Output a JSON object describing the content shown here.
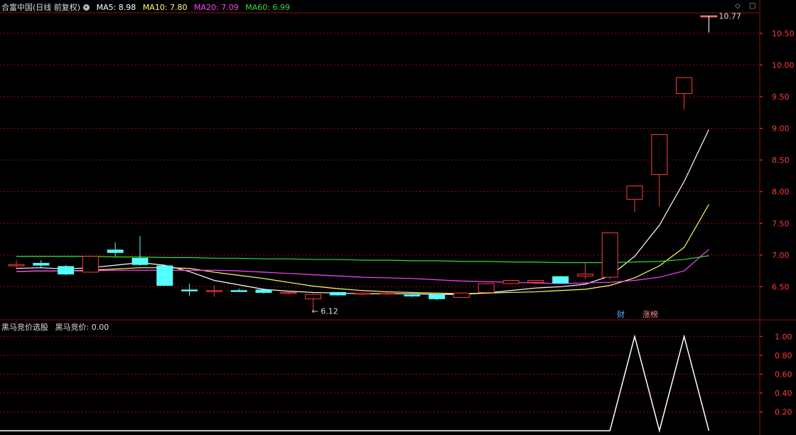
{
  "header_main": {
    "title": "合富中国(日线 前复权)",
    "ma5": "MA5: 8.98",
    "ma10": "MA10: 7.80",
    "ma20": "MA20: 7.09",
    "ma60": "MA60: 6.99"
  },
  "header_sub": {
    "title": "黑马竞价选股",
    "value": "黑马竞价: 0.00"
  },
  "tags": {
    "finance": "财",
    "limit_up": "涨榜"
  },
  "annotations": {
    "high": "10.77",
    "low": "6.12"
  },
  "colors": {
    "up": "#ff3b3b",
    "down": "#54ffff",
    "grid": "#8a1010",
    "ma5": "#ffffff",
    "ma10": "#ffff66",
    "ma20": "#ff44ff",
    "ma60": "#33dd33",
    "axis_text": "#ff3b3b"
  },
  "icons": {
    "settings": "diamond-icon",
    "close": "square-icon",
    "dropdown": "dot-dropdown-icon"
  },
  "chart_data": [
    {
      "type": "candlestick",
      "title": "合富中国(日线 前复权)",
      "ylim": [
        6.0,
        10.8
      ],
      "yticks": [
        6.5,
        7.0,
        7.5,
        8.0,
        8.5,
        9.0,
        9.5,
        10.0,
        10.5
      ],
      "candles": [
        {
          "o": 6.83,
          "h": 6.92,
          "l": 6.77,
          "c": 6.85
        },
        {
          "o": 6.87,
          "h": 6.92,
          "l": 6.8,
          "c": 6.84
        },
        {
          "o": 6.82,
          "h": 6.84,
          "l": 6.68,
          "c": 6.7
        },
        {
          "o": 6.73,
          "h": 6.99,
          "l": 6.72,
          "c": 6.98
        },
        {
          "o": 7.08,
          "h": 7.2,
          "l": 6.98,
          "c": 7.04
        },
        {
          "o": 6.95,
          "h": 7.3,
          "l": 6.83,
          "c": 6.85
        },
        {
          "o": 6.83,
          "h": 6.84,
          "l": 6.52,
          "c": 6.52
        },
        {
          "o": 6.45,
          "h": 6.55,
          "l": 6.35,
          "c": 6.44
        },
        {
          "o": 6.44,
          "h": 6.52,
          "l": 6.34,
          "c": 6.44
        },
        {
          "o": 6.44,
          "h": 6.47,
          "l": 6.42,
          "c": 6.43
        },
        {
          "o": 6.45,
          "h": 6.47,
          "l": 6.39,
          "c": 6.41
        },
        {
          "o": 6.4,
          "h": 6.43,
          "l": 6.38,
          "c": 6.41
        },
        {
          "o": 6.31,
          "h": 6.4,
          "l": 6.12,
          "c": 6.38
        },
        {
          "o": 6.41,
          "h": 6.42,
          "l": 6.36,
          "c": 6.37
        },
        {
          "o": 6.38,
          "h": 6.41,
          "l": 6.37,
          "c": 6.4
        },
        {
          "o": 6.39,
          "h": 6.41,
          "l": 6.37,
          "c": 6.4
        },
        {
          "o": 6.37,
          "h": 6.4,
          "l": 6.34,
          "c": 6.36
        },
        {
          "o": 6.37,
          "h": 6.39,
          "l": 6.29,
          "c": 6.31
        },
        {
          "o": 6.33,
          "h": 6.41,
          "l": 6.33,
          "c": 6.4
        },
        {
          "o": 6.41,
          "h": 6.55,
          "l": 6.4,
          "c": 6.55
        },
        {
          "o": 6.55,
          "h": 6.61,
          "l": 6.54,
          "c": 6.6
        },
        {
          "o": 6.57,
          "h": 6.61,
          "l": 6.54,
          "c": 6.6
        },
        {
          "o": 6.66,
          "h": 6.67,
          "l": 6.55,
          "c": 6.56
        },
        {
          "o": 6.67,
          "h": 6.89,
          "l": 6.62,
          "c": 6.7
        },
        {
          "o": 6.65,
          "h": 7.35,
          "l": 6.62,
          "c": 7.35
        },
        {
          "o": 7.88,
          "h": 8.1,
          "l": 7.68,
          "c": 8.09
        },
        {
          "o": 8.27,
          "h": 8.9,
          "l": 7.77,
          "c": 8.9
        },
        {
          "o": 9.55,
          "h": 9.8,
          "l": 9.3,
          "c": 9.8
        },
        {
          "o": 10.77,
          "h": 10.77,
          "l": 10.5,
          "c": 10.77
        }
      ],
      "series": [
        {
          "name": "MA5",
          "values": [
            6.79,
            6.8,
            6.78,
            6.8,
            6.84,
            6.88,
            6.84,
            6.74,
            6.6,
            6.53,
            6.46,
            6.43,
            6.41,
            6.4,
            6.39,
            6.39,
            6.39,
            6.38,
            6.38,
            6.4,
            6.44,
            6.48,
            6.5,
            6.54,
            6.67,
            6.98,
            7.47,
            8.16,
            8.98
          ]
        },
        {
          "name": "MA10",
          "values": [
            6.74,
            6.75,
            6.75,
            6.76,
            6.78,
            6.8,
            6.8,
            6.79,
            6.73,
            6.68,
            6.63,
            6.57,
            6.51,
            6.47,
            6.44,
            6.42,
            6.41,
            6.4,
            6.39,
            6.4,
            6.41,
            6.42,
            6.44,
            6.46,
            6.52,
            6.64,
            6.83,
            7.12,
            7.8
          ]
        },
        {
          "name": "MA20",
          "values": [
            6.74,
            6.75,
            6.75,
            6.75,
            6.76,
            6.76,
            6.76,
            6.76,
            6.76,
            6.75,
            6.73,
            6.71,
            6.69,
            6.67,
            6.65,
            6.64,
            6.63,
            6.61,
            6.59,
            6.58,
            6.57,
            6.56,
            6.55,
            6.56,
            6.57,
            6.6,
            6.65,
            6.75,
            7.09
          ]
        },
        {
          "name": "MA60",
          "values": [
            6.98,
            6.98,
            6.98,
            6.98,
            6.97,
            6.97,
            6.96,
            6.96,
            6.95,
            6.95,
            6.94,
            6.94,
            6.93,
            6.93,
            6.92,
            6.92,
            6.91,
            6.91,
            6.9,
            6.9,
            6.89,
            6.89,
            6.88,
            6.88,
            6.88,
            6.89,
            6.9,
            6.93,
            6.99
          ]
        }
      ],
      "annotations": [
        {
          "label": "10.77",
          "index": 28,
          "value": 10.77
        },
        {
          "label": "6.12",
          "index": 12,
          "value": 6.12
        }
      ]
    },
    {
      "type": "line",
      "title": "黑马竞价选股",
      "ylim": [
        0,
        1.1
      ],
      "yticks": [
        0.2,
        0.4,
        0.6,
        0.8,
        1.0
      ],
      "series": [
        {
          "name": "黑马竞价",
          "values": [
            0,
            0,
            0,
            0,
            0,
            0,
            0,
            0,
            0,
            0,
            0,
            0,
            0,
            0,
            0,
            0,
            0,
            0,
            0,
            0,
            0,
            0,
            0,
            0,
            0,
            1,
            0,
            1,
            0
          ]
        }
      ]
    }
  ]
}
